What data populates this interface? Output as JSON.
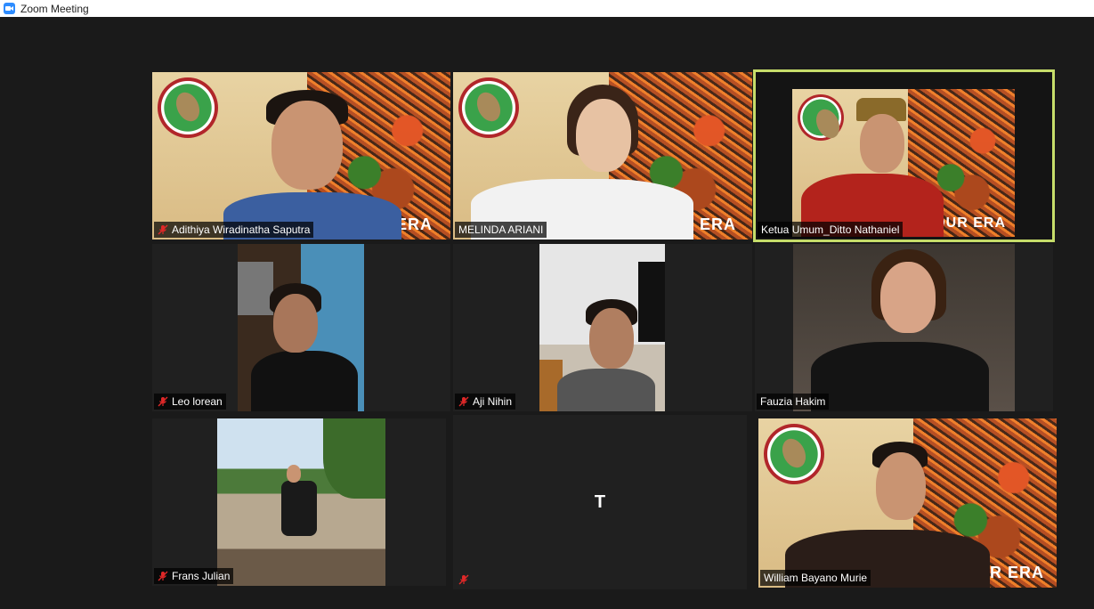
{
  "window": {
    "title": "Zoom Meeting",
    "icon": "zoom-camera-icon"
  },
  "banner": {
    "tagline": "OUR ERA"
  },
  "participants": [
    {
      "name": "Adithiya Wiradinatha Saputra",
      "muted": true,
      "video": "banner"
    },
    {
      "name": "MELINDA  ARIANI",
      "muted": false,
      "video": "banner"
    },
    {
      "name": "Ketua Umum_Ditto Nathaniel",
      "muted": false,
      "video": "banner",
      "active_speaker": true
    },
    {
      "name": "Leo lorean",
      "muted": true,
      "video": "camera"
    },
    {
      "name": "Aji Nihin",
      "muted": true,
      "video": "camera"
    },
    {
      "name": "Fauzia Hakim",
      "muted": false,
      "video": "camera"
    },
    {
      "name": "Frans Julian",
      "muted": true,
      "video": "camera"
    },
    {
      "name": "",
      "initial": "T",
      "muted": true,
      "video": "off"
    },
    {
      "name": "William  Bayano  Murie",
      "muted": false,
      "video": "banner"
    }
  ],
  "colors": {
    "active_border": "#c6dd6a",
    "muted_icon": "#e02828",
    "zoom_blue": "#2d8cff"
  }
}
